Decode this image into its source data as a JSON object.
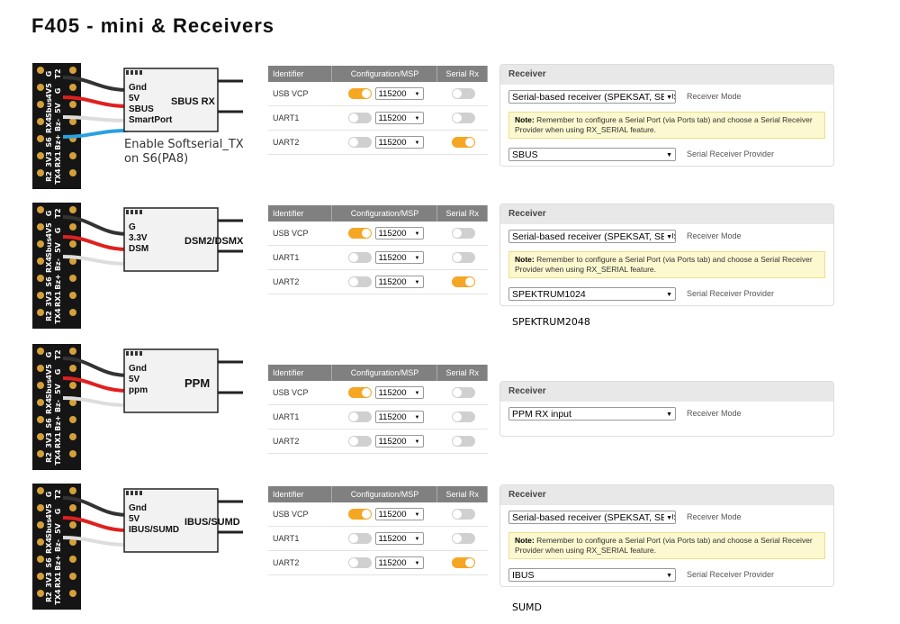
{
  "title": "F405  -  mini  &  Receivers",
  "fc_pads": [
    "G",
    "4V5",
    "Sbus",
    "RX4",
    "S6",
    "3V3",
    "R2",
    "T2",
    "G",
    "5V",
    "Bz-",
    "Bz+",
    "RX1",
    "TX4"
  ],
  "ports_table": {
    "headers": [
      "Identifier",
      "Configuration/MSP",
      "Serial Rx"
    ],
    "rows": [
      "USB VCP",
      "UART1",
      "UART2"
    ],
    "baud": "115200"
  },
  "receiver_panel": {
    "title": "Receiver",
    "mode_label": "Receiver Mode",
    "provider_label": "Serial Receiver Provider",
    "note_bold": "Note:",
    "note_text": " Remember to configure a Serial Port (via Ports tab) and choose a Serial Receiver Provider when using RX_SERIAL feature."
  },
  "sections": [
    {
      "name": "SBUS RX",
      "pins": [
        "Gnd",
        "5V",
        "SBUS",
        "SmartPort"
      ],
      "note": [
        "Enable Softserial_TX",
        "on S6(PA8)"
      ],
      "serial_rx": [
        false,
        false,
        true
      ],
      "mode": "Serial-based receiver (SPEKSAT, SBUS, SUMD)",
      "provider": "SBUS",
      "provider_alt": ""
    },
    {
      "name": "DSM2/DSMX",
      "pins": [
        "G",
        "3.3V",
        "DSM"
      ],
      "note": [],
      "serial_rx": [
        false,
        false,
        true
      ],
      "mode": "Serial-based receiver (SPEKSAT, SBUS, SUMD)",
      "provider": "SPEKTRUM1024",
      "provider_alt": "SPEKTRUM2048"
    },
    {
      "name": "PPM",
      "pins": [
        "Gnd",
        "5V",
        "ppm"
      ],
      "note": [],
      "serial_rx": [
        false,
        false,
        false
      ],
      "mode": "PPM RX input",
      "provider": "",
      "provider_alt": ""
    },
    {
      "name": "IBUS/SUMD",
      "pins": [
        "Gnd",
        "5V",
        "IBUS/SUMD"
      ],
      "note": [],
      "serial_rx": [
        false,
        false,
        true
      ],
      "mode": "Serial-based receiver (SPEKSAT, SBUS, SUMD)",
      "provider": "IBUS",
      "provider_alt": "SUMD"
    }
  ]
}
